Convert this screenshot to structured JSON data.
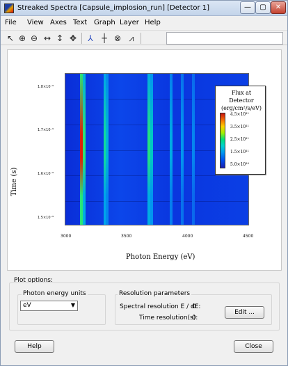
{
  "window": {
    "title": "Streaked Spectra [Capsule_implosion_run] [Detector 1]",
    "controls": {
      "minimize": "—",
      "maximize": "▢",
      "close": "✕"
    }
  },
  "menu": [
    "File",
    "View",
    "Axes",
    "Text",
    "Graph",
    "Layer",
    "Help"
  ],
  "toolbar": {
    "tools": [
      "pointer-icon",
      "zoom-in-icon",
      "zoom-out-icon",
      "pan-horizontal-icon",
      "pan-vertical-icon",
      "pan-all-icon",
      "axes-icon",
      "crosshair-icon",
      "target-icon",
      "graph-icon"
    ]
  },
  "plot": {
    "xlabel": "Photon Energy (eV)",
    "ylabel": "Time (s)",
    "x_ticks": [
      "3000",
      "3500",
      "4000",
      "4500"
    ],
    "y_ticks": [
      "1.8×10⁻⁹",
      "1.7×10⁻⁹",
      "1.6×10⁻⁹",
      "1.5×10⁻⁹"
    ],
    "legend": {
      "title_line1": "Flux at Detector",
      "title_line2": "(erg/cm²/s/eV)",
      "labels": [
        "4.5×10¹¹",
        "3.5×10¹¹",
        "2.5×10¹¹",
        "1.5×10¹¹",
        "5.0×10¹⁰"
      ]
    }
  },
  "chart_data": {
    "type": "heatmap",
    "title": "",
    "xlabel": "Photon Energy (eV)",
    "ylabel": "Time (s)",
    "x_ticks": [
      "3000",
      "3500",
      "4000",
      "4500"
    ],
    "colorbar": {
      "title": "Flux at Detector (erg/cm²/s/eV)",
      "ticks": [
        "4.5×10¹¹",
        "3.5×10¹¹",
        "2.5×10¹¹",
        "1.5×10¹¹",
        "5.0×10¹⁰"
      ]
    },
    "bands": [
      {
        "energy_eV": 3130,
        "peak_flux": 450000000000.0
      },
      {
        "energy_eV": 3150,
        "peak_flux": 250000000000.0
      },
      {
        "energy_eV": 3320,
        "peak_flux": 220000000000.0
      },
      {
        "energy_eV": 3340,
        "peak_flux": 150000000000.0
      },
      {
        "energy_eV": 3680,
        "peak_flux": 240000000000.0
      },
      {
        "energy_eV": 3700,
        "peak_flux": 180000000000.0
      },
      {
        "energy_eV": 3860,
        "peak_flux": 130000000000.0
      },
      {
        "energy_eV": 3950,
        "peak_flux": 100000000000.0
      },
      {
        "energy_eV": 4040,
        "peak_flux": 80000000000.0
      }
    ]
  },
  "plot_options": {
    "caption": "Plot options:",
    "units": {
      "caption": "Photon energy units",
      "selected": "eV"
    },
    "resolution": {
      "caption": "Resolution parameters",
      "spectral_label": "Spectral resolution E / dE:",
      "spectral_value": "0",
      "time_label": "Time resolution(s):",
      "time_value": "0",
      "edit_button": "Edit ..."
    }
  },
  "footer": {
    "help_button": "Help",
    "close_button": "Close"
  }
}
